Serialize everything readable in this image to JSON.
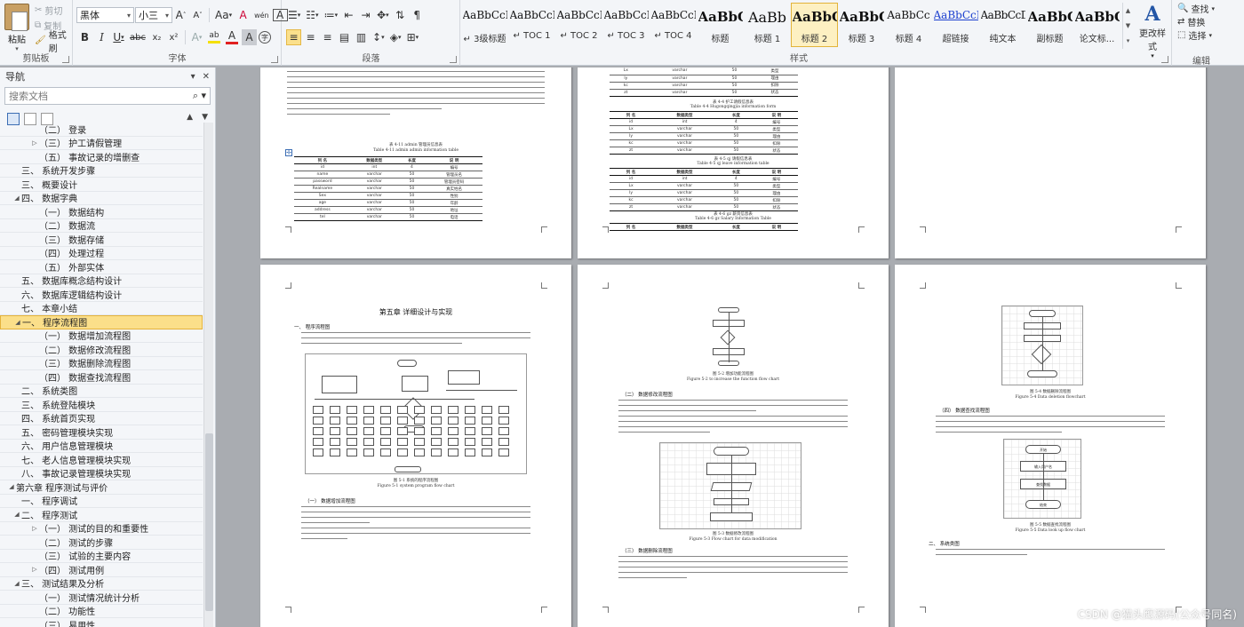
{
  "ribbon": {
    "clipboard": {
      "paste": "粘贴",
      "cut": "剪切",
      "copy": "复制",
      "format_painter": "格式刷",
      "group_label": "剪贴板"
    },
    "font": {
      "family": "黑体",
      "size": "小三",
      "grow": "A",
      "shrink": "A",
      "case": "Aa",
      "clear": "A",
      "wen": "wén",
      "border_a": "A",
      "bold": "B",
      "italic": "I",
      "underline": "U",
      "strike": "abc",
      "subscript": "x₂",
      "superscript": "x²",
      "effects": "A",
      "highlight": "ab",
      "color": "A",
      "char_shade": "A",
      "enclose": "字",
      "group_label": "字体"
    },
    "paragraph": {
      "group_label": "段落"
    },
    "styles": {
      "items": [
        {
          "preview": "AaBbCcI",
          "name": "↵ 3级标题"
        },
        {
          "preview": "AaBbCcI",
          "name": "↵ TOC 1"
        },
        {
          "preview": "AaBbCcI",
          "name": "↵ TOC 2"
        },
        {
          "preview": "AaBbCcI",
          "name": "↵ TOC 3"
        },
        {
          "preview": "AaBbCcI",
          "name": "↵ TOC 4"
        },
        {
          "preview": "AaBbC",
          "name": "标题"
        },
        {
          "preview": "AaBb",
          "name": "标题 1"
        },
        {
          "preview": "AaBbC",
          "name": "标题 2"
        },
        {
          "preview": "AaBbC",
          "name": "标题 3"
        },
        {
          "preview": "AaBbCc",
          "name": "标题 4"
        },
        {
          "preview": "AaBbCcI",
          "name": "超链接"
        },
        {
          "preview": "AaBbCcDc",
          "name": "纯文本"
        },
        {
          "preview": "AaBbC",
          "name": "副标题"
        },
        {
          "preview": "AaBbC",
          "name": "论文标..."
        }
      ],
      "selected_index": 7,
      "change_styles": "更改样式",
      "group_label": "样式"
    },
    "editing": {
      "find": "查找",
      "replace": "替换",
      "select": "选择",
      "group_label": "编辑"
    }
  },
  "nav": {
    "title": "导航",
    "search_placeholder": "搜索文档",
    "items": [
      {
        "label": "（二） 登录",
        "level": 2,
        "toggle": ""
      },
      {
        "label": "（三） 护工请假管理",
        "level": 2,
        "toggle": "▷"
      },
      {
        "label": "（五） 事故记录的增删查",
        "level": 2,
        "toggle": ""
      },
      {
        "label": "三、 系统开发步骤",
        "level": 1,
        "toggle": ""
      },
      {
        "label": "三、 概要设计",
        "level": 1,
        "toggle": ""
      },
      {
        "label": "四、 数据字典",
        "level": 1,
        "toggle": "◢"
      },
      {
        "label": "（一） 数据结构",
        "level": 2,
        "toggle": ""
      },
      {
        "label": "（二） 数据流",
        "level": 2,
        "toggle": ""
      },
      {
        "label": "（三） 数据存储",
        "level": 2,
        "toggle": ""
      },
      {
        "label": "（四） 处理过程",
        "level": 2,
        "toggle": ""
      },
      {
        "label": "（五） 外部实体",
        "level": 2,
        "toggle": ""
      },
      {
        "label": "五、 数据库概念结构设计",
        "level": 1,
        "toggle": ""
      },
      {
        "label": "六、 数据库逻辑结构设计",
        "level": 1,
        "toggle": ""
      },
      {
        "label": "七、 本章小结",
        "level": 1,
        "toggle": ""
      },
      {
        "label": "一、 程序流程图",
        "level": 1,
        "toggle": "◢",
        "selected": true
      },
      {
        "label": "（一） 数据增加流程图",
        "level": 2,
        "toggle": ""
      },
      {
        "label": "（二） 数据修改流程图",
        "level": 2,
        "toggle": ""
      },
      {
        "label": "（三） 数据删除流程图",
        "level": 2,
        "toggle": ""
      },
      {
        "label": "（四） 数据查找流程图",
        "level": 2,
        "toggle": ""
      },
      {
        "label": "二、 系统类图",
        "level": 1,
        "toggle": ""
      },
      {
        "label": "三、 系统登陆模块",
        "level": 1,
        "toggle": ""
      },
      {
        "label": "四、 系统首页实现",
        "level": 1,
        "toggle": ""
      },
      {
        "label": "五、 密码管理模块实现",
        "level": 1,
        "toggle": ""
      },
      {
        "label": "六、 用户信息管理模块",
        "level": 1,
        "toggle": ""
      },
      {
        "label": "七、 老人信息管理模块实现",
        "level": 1,
        "toggle": ""
      },
      {
        "label": "八、 事故记录管理模块实现",
        "level": 1,
        "toggle": ""
      },
      {
        "label": "第六章 程序测试与评价",
        "level": 0,
        "toggle": "◢"
      },
      {
        "label": "一、 程序调试",
        "level": 1,
        "toggle": ""
      },
      {
        "label": "二、 程序测试",
        "level": 1,
        "toggle": "◢"
      },
      {
        "label": "（一） 测试的目的和重要性",
        "level": 2,
        "toggle": "▷"
      },
      {
        "label": "（二） 测试的步骤",
        "level": 2,
        "toggle": ""
      },
      {
        "label": "（三） 试验的主要内容",
        "level": 2,
        "toggle": ""
      },
      {
        "label": "（四） 测试用例",
        "level": 2,
        "toggle": "▷"
      },
      {
        "label": "三、 测试结果及分析",
        "level": 1,
        "toggle": "◢"
      },
      {
        "label": "（一） 测试情况统计分析",
        "level": 2,
        "toggle": ""
      },
      {
        "label": "（二） 功能性",
        "level": 2,
        "toggle": ""
      },
      {
        "label": "（三） 易用性",
        "level": 2,
        "toggle": ""
      }
    ]
  },
  "pages": {
    "p1": {
      "caption_cn": "表 4-11 admin 管理员信息表",
      "caption_en": "Table 4-11 admin admin information table",
      "headers": [
        "列 名",
        "数据类型",
        "长度",
        "说 明"
      ],
      "rows": [
        [
          "id",
          "int",
          "4",
          "编号"
        ],
        [
          "name",
          "varchar",
          "50",
          "管理员名"
        ],
        [
          "password",
          "varchar",
          "50",
          "管理员密码"
        ],
        [
          "Realname",
          "varchar",
          "50",
          "真实姓名"
        ],
        [
          "Sex",
          "varchar",
          "50",
          "性别"
        ],
        [
          "age",
          "varchar",
          "50",
          "年龄"
        ],
        [
          "address",
          "varchar",
          "50",
          "地址"
        ],
        [
          "tel",
          "varchar",
          "50",
          "电话"
        ]
      ]
    },
    "p2": {
      "caption1_cn": "表 4-4 护工请假信息表",
      "caption1_en": "Table 4-4 Hugongqingjia information form",
      "caption2_cn": "表 4-5 qj 请假信息表",
      "caption2_en": "Table 4-5 qj leave information table",
      "caption3_cn": "表 4-6 gz 薪资信息表",
      "caption3_en": "Table 4-6 gz Salary Information Table",
      "headers": [
        "列 名",
        "数据类型",
        "长度",
        "说 明"
      ],
      "rows": [
        [
          "id",
          "int",
          "4",
          "编号"
        ],
        [
          "Lx",
          "varchar",
          "50",
          "类型"
        ],
        [
          "ly",
          "varchar",
          "50",
          "理由"
        ],
        [
          "kc",
          "varchar",
          "50",
          "扣除"
        ],
        [
          "zt",
          "varchar",
          "50",
          "状态"
        ]
      ]
    },
    "p4": {
      "chapter": "第五章 详细设计与实现",
      "h_flow": "一、 程序流程图",
      "fig1_cn": "图 5-1 系统的程序流程图",
      "fig1_en": "Figure 5-1 system program flow chart",
      "h_add": "（一） 数据增加流程图"
    },
    "p5": {
      "fig2_cn": "图 5-2 增加功能流程图",
      "fig2_en": "Figure 5-2 to increase the function flow chart",
      "h_edit": "（二） 数据修改流程图",
      "fig3_cn": "图 5-3 数据修改流程图",
      "fig3_en": "Figure 5-3 Flow chart for data modification",
      "h_del": "（三） 数据删除流程图"
    },
    "p6": {
      "fig4_cn": "图 5-4 数据删除流程图",
      "fig4_en": "Figure 5-4 Data deletion flowchart",
      "h_find": "（四） 数据查找流程图",
      "fig5_cn": "图 5-5 数据查找流程图",
      "fig5_en": "Figure 5-5 Data look up flow chart",
      "h_class": "二、 系统类图",
      "flow_start": "开始",
      "flow_input": "输入用户名",
      "flow_find": "查找数据",
      "flow_end": "结束"
    }
  },
  "watermark": "CSDN @猫头鹰源码(公众号同名)",
  "colors": {
    "highlight_yellow": "#f4e00a",
    "font_red": "#e02020",
    "selection": "#fbdf8a"
  }
}
